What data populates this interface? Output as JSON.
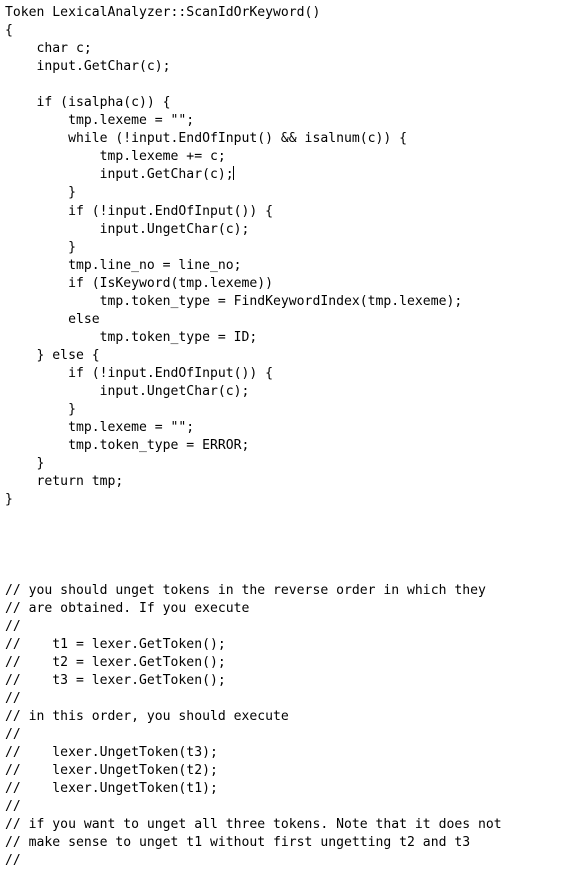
{
  "document": {
    "kind": "source-code-listing",
    "language": "cpp",
    "background_color": "#ffffff",
    "text_color": "#000000",
    "caret_color": "#000000",
    "caret": {
      "line_index": 9,
      "after_text": "            input.GetChar(c);"
    },
    "lines": [
      "Token LexicalAnalyzer::ScanIdOrKeyword()",
      "{",
      "    char c;",
      "    input.GetChar(c);",
      "",
      "    if (isalpha(c)) {",
      "        tmp.lexeme = \"\";",
      "        while (!input.EndOfInput() && isalnum(c)) {",
      "            tmp.lexeme += c;",
      "            input.GetChar(c);",
      "        }",
      "        if (!input.EndOfInput()) {",
      "            input.UngetChar(c);",
      "        }",
      "        tmp.line_no = line_no;",
      "        if (IsKeyword(tmp.lexeme))",
      "            tmp.token_type = FindKeywordIndex(tmp.lexeme);",
      "        else",
      "            tmp.token_type = ID;",
      "    } else {",
      "        if (!input.EndOfInput()) {",
      "            input.UngetChar(c);",
      "        }",
      "        tmp.lexeme = \"\";",
      "        tmp.token_type = ERROR;",
      "    }",
      "    return tmp;",
      "}",
      "",
      "",
      "",
      "",
      "// you should unget tokens in the reverse order in which they",
      "// are obtained. If you execute",
      "//",
      "//    t1 = lexer.GetToken();",
      "//    t2 = lexer.GetToken();",
      "//    t3 = lexer.GetToken();",
      "//",
      "// in this order, you should execute",
      "//",
      "//    lexer.UngetToken(t3);",
      "//    lexer.UngetToken(t2);",
      "//    lexer.UngetToken(t1);",
      "//",
      "// if you want to unget all three tokens. Note that it does not",
      "// make sense to unget t1 without first ungetting t2 and t3",
      "//"
    ]
  }
}
